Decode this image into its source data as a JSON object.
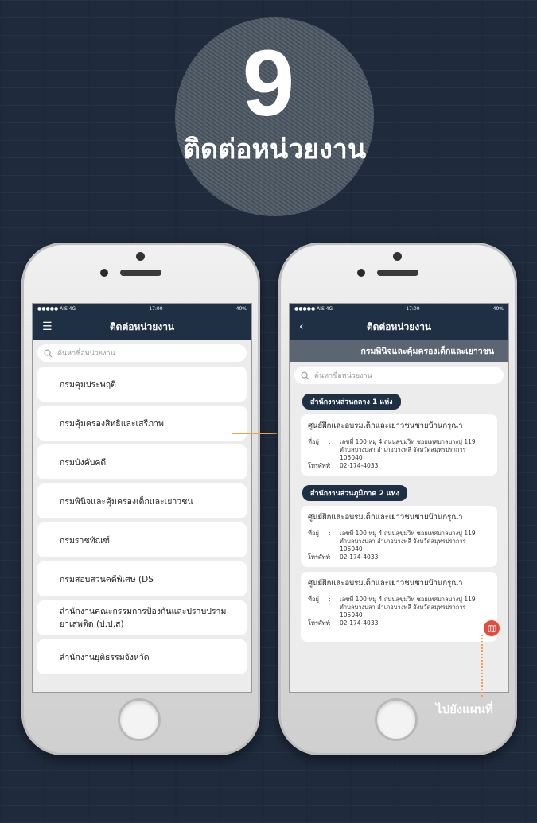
{
  "badge": {
    "number": "9",
    "title": "ติดต่อหน่วยงาน"
  },
  "status_bar": {
    "carrier": "●●●●● AIS  4G",
    "time": "17:00",
    "battery": "40%"
  },
  "left_screen": {
    "nav_title": "ติดต่อหน่วยงาน",
    "menu_icon": "hamburger-icon",
    "search_placeholder": "ค้นหาชื่อหน่วยงาน",
    "items": [
      "กรมคุมประพฤติ",
      "กรมคุ้มครองสิทธิและเสรีภาพ",
      "กรมบังคับคดี",
      "กรมพินิจและคุ้มครองเด็กและเยาวชน",
      "กรมราชทัณฑ์",
      "กรมสอบสวนคดีพิเศษ (DS",
      "สำนักงานคณะกรรมการป้องกันและปราบปราม ยาเสพติด (ป.ป.ส)",
      "สำนักงานยุติธรรมจังหวัด"
    ]
  },
  "right_screen": {
    "nav_title": "ติดต่อหน่วยงาน",
    "back_icon": "chevron-left-icon",
    "subheader": "กรมพินิจและคุ้มครองเด็กและเยาวชน",
    "search_placeholder": "ค้นหาชื่อหน่วยงาน",
    "sections": [
      {
        "label": "สำนักงานส่วนกลาง 1 แห่ง",
        "cards": [
          {
            "title": "ศูนย์ฝึกและอบรมเด็กและเยาวชนชายบ้านกรุณา",
            "address_label": "ที่อยู่",
            "address_line1": "เลขที่ 100 หมู่ 4 ถนนสุขุมวิท ซอยเทศบาลบางปู 119",
            "address_line2": "ตำบลบางปลา อำเภอบางพลี จังหวัดสมุทรปราการ 105040",
            "phone_label": "โทรศัพท์",
            "phone": "02-174-4033"
          }
        ]
      },
      {
        "label": "สำนักงานส่วนภูมิภาค 2 แห่ง",
        "cards": [
          {
            "title": "ศูนย์ฝึกและอบรมเด็กและเยาวชนชายบ้านกรุณา",
            "address_label": "ที่อยู่",
            "address_line1": "เลขที่ 100 หมู่ 4 ถนนสุขุมวิท ซอยเทศบาลบางปู 119",
            "address_line2": "ตำบลบางปลา อำเภอบางพลี จังหวัดสมุทรปราการ 105040",
            "phone_label": "โทรศัพท์",
            "phone": "02-174-4033"
          },
          {
            "title": "ศูนย์ฝึกและอบรมเด็กและเยาวชนชายบ้านกรุณา",
            "address_label": "ที่อยู่",
            "address_line1": "เลขที่ 100 หมู่ 4 ถนนสุขุมวิท ซอยเทศบาลบางปู 119",
            "address_line2": "ตำบลบางปลา อำเภอบางพลี จังหวัดสมุทรปราการ 105040",
            "phone_label": "โทรศัพท์",
            "phone": "02-174-4033"
          }
        ]
      }
    ],
    "map_button_icon": "map-icon"
  },
  "map_callout": "ไปยังแผนที่",
  "colors": {
    "navbar": "#203044",
    "accent": "#f0a050",
    "map_button": "#e54b3c",
    "background": "#1f2b3c"
  }
}
